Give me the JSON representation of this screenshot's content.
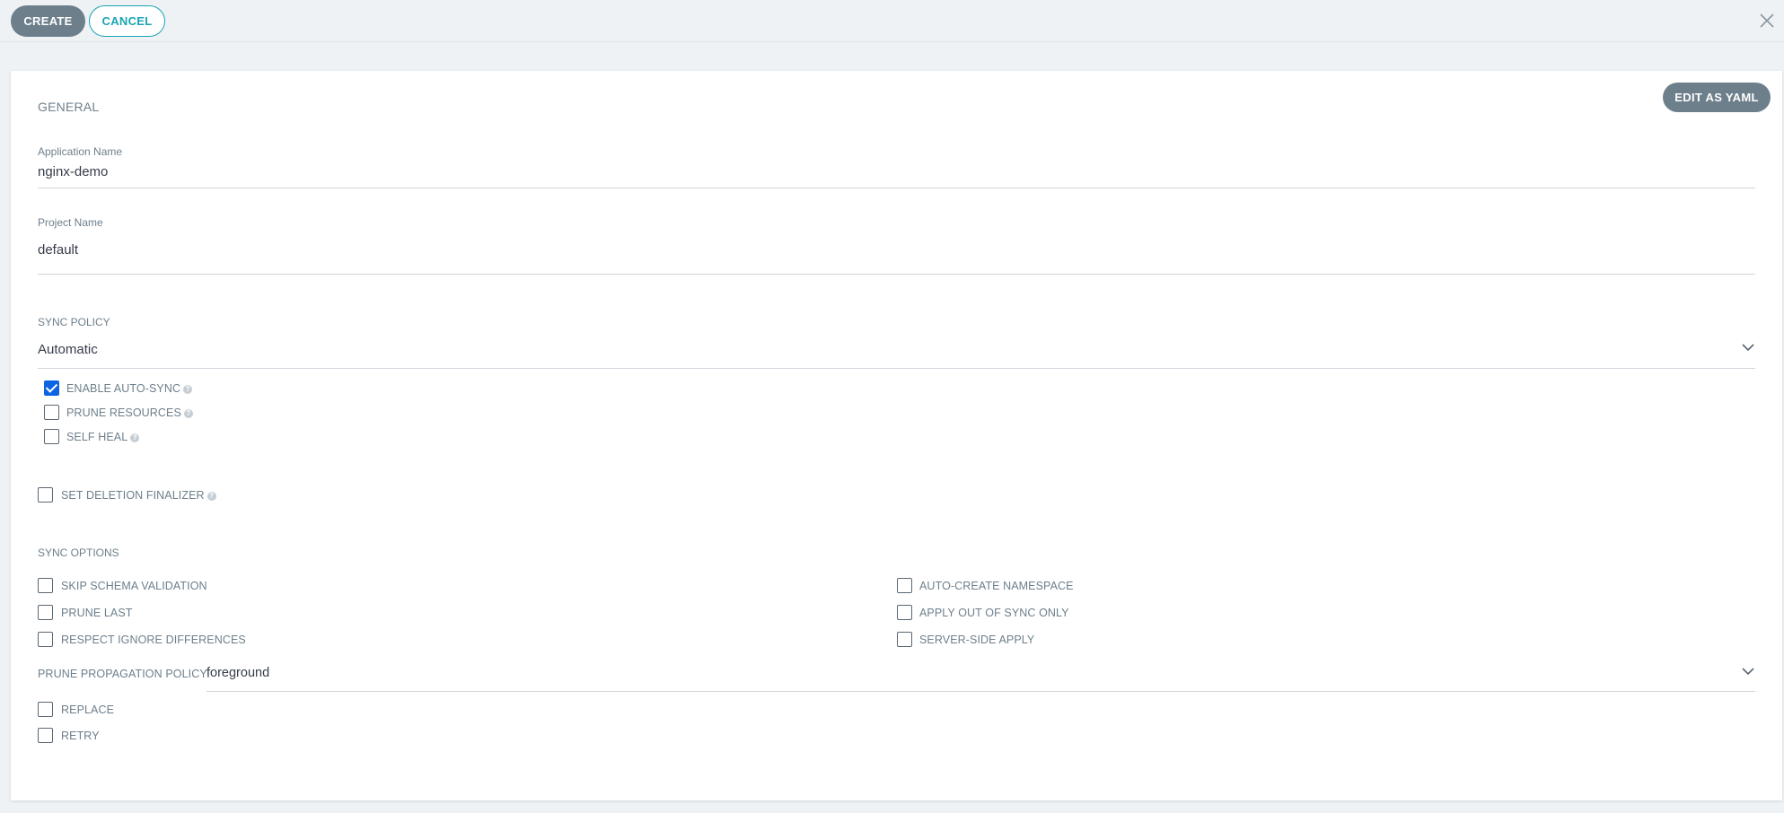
{
  "toolbar": {
    "create_label": "CREATE",
    "cancel_label": "CANCEL"
  },
  "edit_yaml_label": "EDIT AS YAML",
  "general": {
    "title": "GENERAL",
    "app_name_label": "Application Name",
    "app_name_value": "nginx-demo",
    "project_label": "Project Name",
    "project_value": "default"
  },
  "sync_policy": {
    "title": "SYNC POLICY",
    "value": "Automatic",
    "enable_auto_sync": {
      "label": "ENABLE AUTO-SYNC",
      "checked": true
    },
    "prune_resources": {
      "label": "PRUNE RESOURCES",
      "checked": false
    },
    "self_heal": {
      "label": "SELF HEAL",
      "checked": false
    }
  },
  "deletion_finalizer": {
    "label": "SET DELETION FINALIZER",
    "checked": false
  },
  "sync_options": {
    "title": "SYNC OPTIONS",
    "left": [
      {
        "label": "SKIP SCHEMA VALIDATION",
        "checked": false
      },
      {
        "label": "PRUNE LAST",
        "checked": false
      },
      {
        "label": "RESPECT IGNORE DIFFERENCES",
        "checked": false
      }
    ],
    "right": [
      {
        "label": "AUTO-CREATE NAMESPACE",
        "checked": false
      },
      {
        "label": "APPLY OUT OF SYNC ONLY",
        "checked": false
      },
      {
        "label": "SERVER-SIDE APPLY",
        "checked": false
      }
    ],
    "prune_policy_label": "PRUNE PROPAGATION POLICY:",
    "prune_policy_value": "foreground",
    "replace": {
      "label": "REPLACE",
      "checked": false
    },
    "retry": {
      "label": "RETRY",
      "checked": false
    }
  },
  "icons": {
    "close": "close-icon",
    "chevron": "chevron-down-icon",
    "help": "help-icon",
    "check": "check-icon"
  },
  "colors": {
    "primary_button": "#6d7f8b",
    "accent": "#1aa4b4",
    "checkbox_checked": "#0c63e4"
  }
}
